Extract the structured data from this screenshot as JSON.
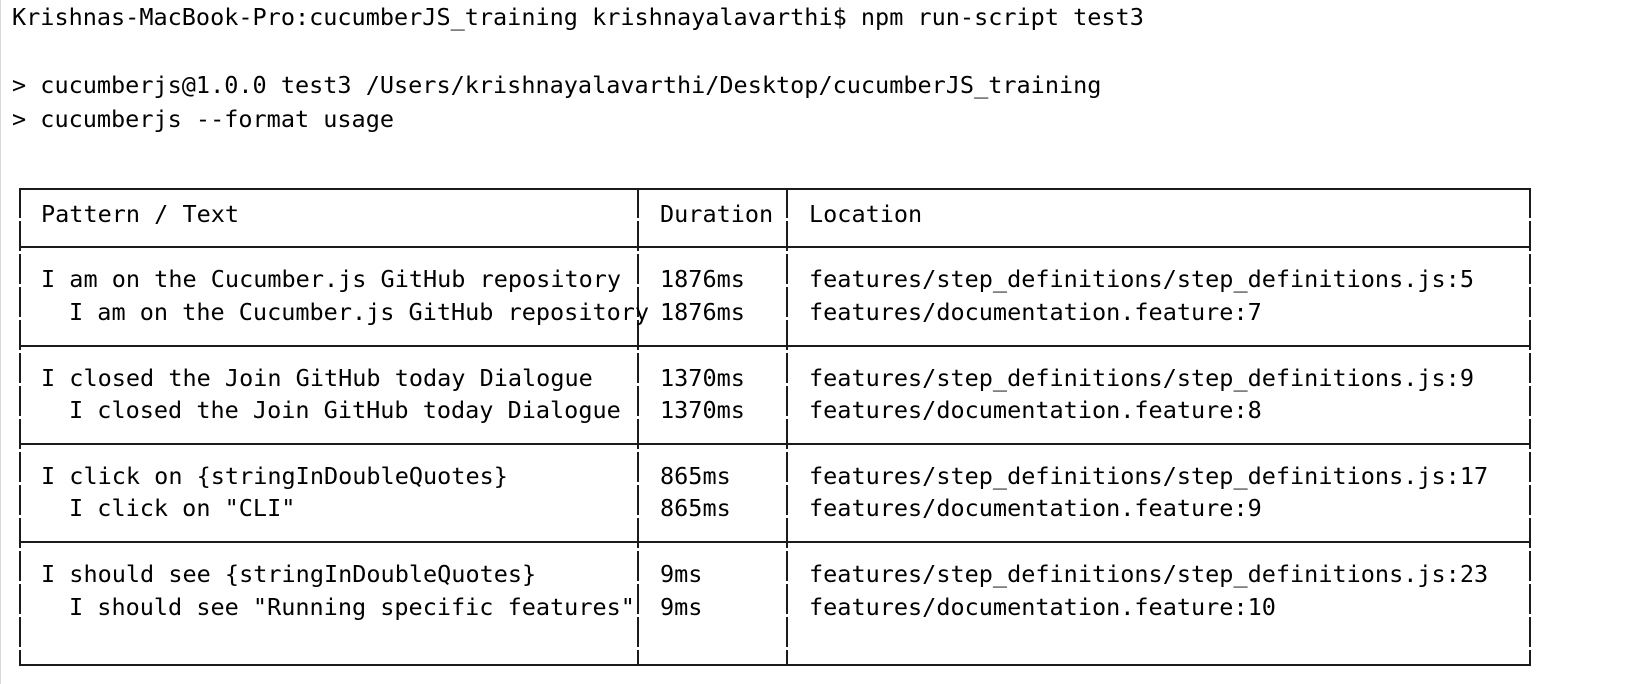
{
  "terminal": {
    "prompt": "Krishnas-MacBook-Pro:cucumberJS_training krishnayalavarthi$ npm run-script test3",
    "script_line": "> cucumberjs@1.0.0 test3 /Users/krishnayalavarthi/Desktop/cucumberJS_training",
    "command_line": "> cucumberjs --format usage"
  },
  "table": {
    "headers": {
      "pattern": "Pattern / Text",
      "duration": "Duration",
      "location": "Location"
    },
    "groups": [
      {
        "pattern": "I am on the Cucumber.js GitHub repository",
        "pattern_duration": "1876ms",
        "pattern_location": "features/step_definitions/step_definitions.js:5",
        "text": "I am on the Cucumber.js GitHub repository",
        "text_duration": "1876ms",
        "text_location": "features/documentation.feature:7"
      },
      {
        "pattern": "I closed the Join GitHub today Dialogue",
        "pattern_duration": "1370ms",
        "pattern_location": "features/step_definitions/step_definitions.js:9",
        "text": "I closed the Join GitHub today Dialogue",
        "text_duration": "1370ms",
        "text_location": "features/documentation.feature:8"
      },
      {
        "pattern": "I click on {stringInDoubleQuotes}",
        "pattern_duration": "865ms",
        "pattern_location": "features/step_definitions/step_definitions.js:17",
        "text": "I click on \"CLI\"",
        "text_duration": "865ms",
        "text_location": "features/documentation.feature:9"
      },
      {
        "pattern": "I should see {stringInDoubleQuotes}",
        "pattern_duration": "9ms",
        "pattern_location": "features/step_definitions/step_definitions.js:23",
        "text": "I should see \"Running specific features\"",
        "text_duration": "9ms",
        "text_location": "features/documentation.feature:10"
      }
    ]
  }
}
